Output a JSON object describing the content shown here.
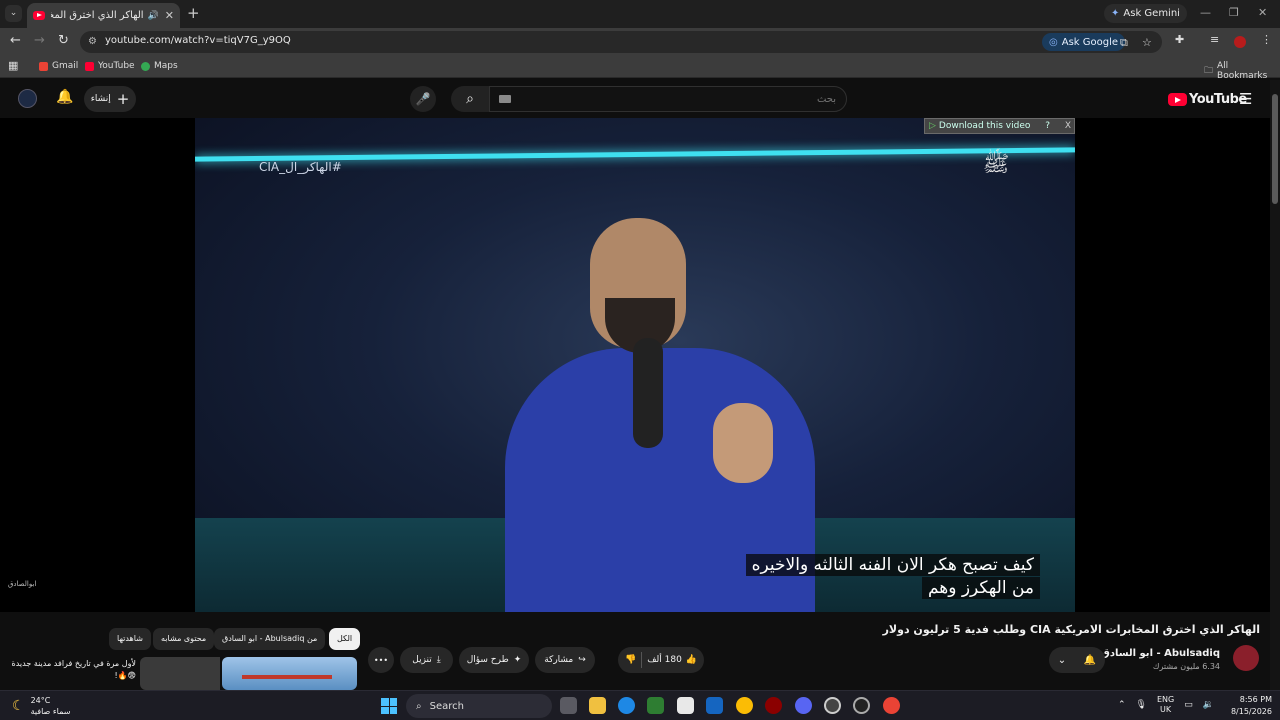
{
  "browser": {
    "tab_title": "الهاكر الذي اخترق المخابرات ال",
    "new_tab_icon": "plus-icon",
    "ask_gemini": "Ask Gemini",
    "url": "youtube.com/watch?v=tiqV7G_y9OQ",
    "ask_google": "Ask Google",
    "bookmarks": [
      {
        "label": "Gmail",
        "color": "#ea4335"
      },
      {
        "label": "YouTube",
        "color": "#ff0033"
      },
      {
        "label": "Maps",
        "color": "#34a853"
      }
    ],
    "all_bookmarks": "All Bookmarks"
  },
  "youtube": {
    "logo_text": "YouTube",
    "search_placeholder": "بحث",
    "create_label": "إنشاء",
    "accent": "#ff0033"
  },
  "player": {
    "hashtag": "#الهاكر_ال_CIA",
    "download_bar": "Download this video",
    "download_help": "?",
    "download_close": "X",
    "subtitle_line1": "كيف تصبح هكر الان الفنه الثالثه والاخيره",
    "subtitle_line2": "من الهكرز وهم",
    "left_watermark": "ابوالصادق"
  },
  "video": {
    "title": "الهاكر الذي اخترق المخابرات الامريكية CIA وطلب فدية 5 ترليون دولار",
    "channel_name": "Abulsadiq - ابو السادق",
    "subscribers": "6.34 مليون مشترك",
    "likes": "180 ألف",
    "share": "مشاركة",
    "ask": "طرح سؤال",
    "download": "تنزيل",
    "more": "•••"
  },
  "chips": [
    {
      "label": "الكل",
      "active": true
    },
    {
      "label": "من Abulsadiq - ابو السادق",
      "active": false
    },
    {
      "label": "محتوى مشابه",
      "active": false
    },
    {
      "label": "شاهدتها",
      "active": false
    }
  ],
  "recommendation": {
    "title": "لأول مرة في تاريخ فرافد مدينة جديدة 😨🔥!"
  },
  "taskbar": {
    "temperature": "24°C",
    "condition": "سماء صافية",
    "search_label": "Search",
    "language_line1": "ENG",
    "language_line2": "UK",
    "time": "8:56 PM",
    "date": "8/15/2026"
  }
}
